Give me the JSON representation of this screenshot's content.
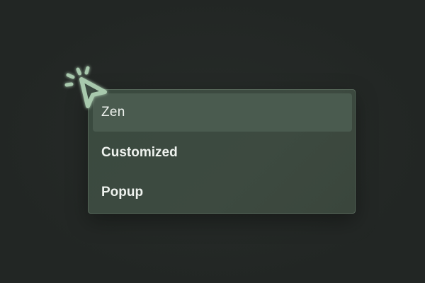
{
  "menu": {
    "items": [
      {
        "label": "Zen",
        "state": "hovered"
      },
      {
        "label": "Customized",
        "state": "normal"
      },
      {
        "label": "Popup",
        "state": "normal"
      }
    ]
  },
  "cursor": {
    "icon": "pointer-click-icon",
    "color": "#a8c9ad"
  },
  "colors": {
    "background": "#232825",
    "menu_background": "#3b4a3f",
    "highlight": "#4a5b4f",
    "text": "#eef2ee"
  }
}
